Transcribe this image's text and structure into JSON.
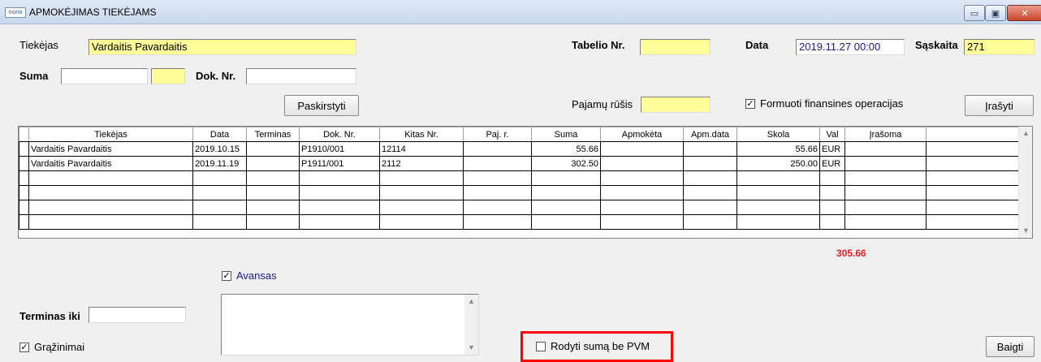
{
  "window": {
    "app_icon_text": "nono",
    "title": "APMOKĖJIMAS TIEKĖJAMS",
    "minimize_glyph": "▭",
    "restore_glyph": "▣",
    "close_glyph": "✕"
  },
  "form": {
    "tiekejas_label": "Tiekėjas",
    "tiekejas_value": "Vardaitis Pavardaitis",
    "tabelio_label": "Tabelio Nr.",
    "tabelio_value": "",
    "data_label": "Data",
    "data_value": "2019.11.27 00:00",
    "saskaita_label": "Sąskaita",
    "saskaita_value": "271",
    "suma_label": "Suma",
    "suma_value": "",
    "suma_extra_value": "",
    "dok_label": "Dok. Nr.",
    "dok_value": "",
    "paskirstyti_label": "Paskirstyti",
    "pajamu_label": "Pajamų rūšis",
    "pajamu_value": "",
    "formuoti_label": "Formuoti finansines operacijas",
    "formuoti_checked": true,
    "irasyti_label": "Įrašyti"
  },
  "table": {
    "columns": [
      "Tiekėjas",
      "Data",
      "Terminas",
      "Dok. Nr.",
      "Kitas Nr.",
      "Paj. r.",
      "Suma",
      "Apmokėta",
      "Apm.data",
      "Skola",
      "Val",
      "Įrašoma",
      ""
    ],
    "rows": [
      [
        "Vardaitis Pavardaitis",
        "2019.10.15",
        "",
        "P1910/001",
        "12114",
        "",
        "55.66",
        "",
        "",
        "55.66",
        "EUR",
        "",
        ""
      ],
      [
        "Vardaitis Pavardaitis",
        "2019.11.19",
        "",
        "P1911/001",
        "2112",
        "",
        "302.50",
        "",
        "",
        "250.00",
        "EUR",
        "",
        ""
      ],
      [
        "",
        "",
        "",
        "",
        "",
        "",
        "",
        "",
        "",
        "",
        "",
        "",
        ""
      ],
      [
        "",
        "",
        "",
        "",
        "",
        "",
        "",
        "",
        "",
        "",
        "",
        "",
        ""
      ],
      [
        "",
        "",
        "",
        "",
        "",
        "",
        "",
        "",
        "",
        "",
        "",
        "",
        ""
      ],
      [
        "",
        "",
        "",
        "",
        "",
        "",
        "",
        "",
        "",
        "",
        "",
        "",
        ""
      ]
    ],
    "scroll_up_glyph": "▲",
    "scroll_down_glyph": "▼"
  },
  "total_value": "305.66",
  "bottom": {
    "avansas_label": "Avansas",
    "avansas_checked": true,
    "terminas_iki_label": "Terminas iki",
    "terminas_iki_value": "",
    "grazinimai_label": "Grąžinimai",
    "grazinimai_checked": true,
    "memo_value": "",
    "rodyti_label": "Rodyti sumą be PVM",
    "rodyti_checked": false,
    "baigti_label": "Baigti",
    "check_glyph": "✓"
  },
  "colors": {
    "highlight": "#ff0000",
    "total": "#e02020",
    "yellow_field": "#ffff99",
    "link_blue": "#1a1a8c"
  }
}
